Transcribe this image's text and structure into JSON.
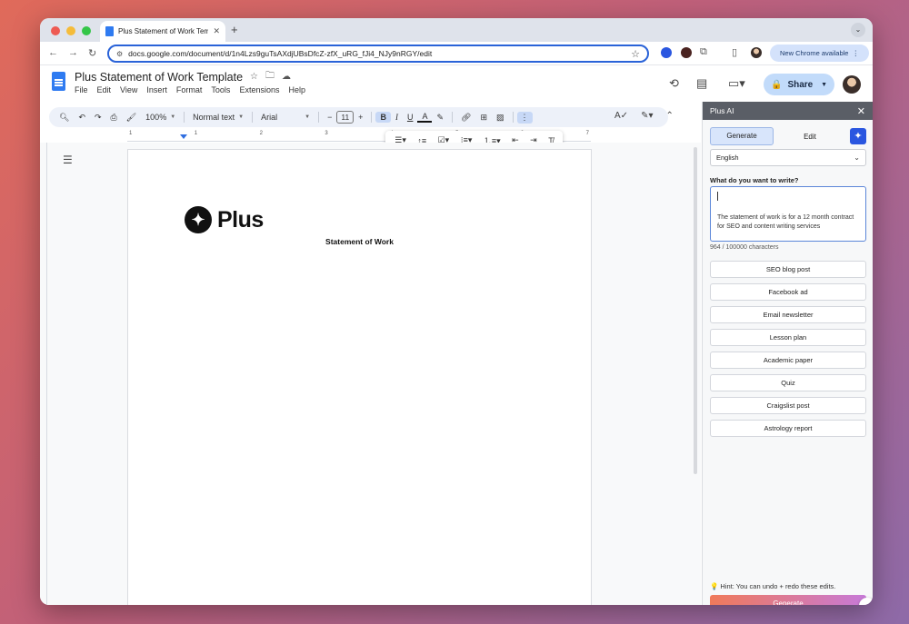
{
  "browser": {
    "tab_title": "Plus Statement of Work Temp",
    "tab_close": "✕",
    "new_tab": "+",
    "url": "docs.google.com/document/d/1n4Lzs9guTsAXdjUBsDfcZ-zfX_uRG_fJi4_NJy9nRGY/edit",
    "chrome_update_label": "New Chrome available",
    "traffic_colors": [
      "#ee5b53",
      "#f5bc3a",
      "#34c648"
    ]
  },
  "docs": {
    "title": "Plus Statement of Work Template",
    "menus": [
      "File",
      "Edit",
      "View",
      "Insert",
      "Format",
      "Tools",
      "Extensions",
      "Help"
    ],
    "share_label": "Share",
    "toolbar": {
      "zoom": "100%",
      "style": "Normal text",
      "font": "Arial",
      "font_size": "11"
    },
    "ruler_numbers": [
      "1",
      "1",
      "2",
      "3",
      "4",
      "5",
      "6",
      "7"
    ]
  },
  "document": {
    "logo_word": "Plus",
    "heading": "Statement of Work"
  },
  "panel": {
    "title": "Plus AI",
    "tab_generate": "Generate",
    "tab_edit": "Edit",
    "language": "English",
    "question": "What do you want to write?",
    "prompt_text": "The statement of work is for a 12 month contract for SEO and content writing services",
    "char_count": "964 / 100000 characters",
    "templates": [
      "SEO blog post",
      "Facebook ad",
      "Email newsletter",
      "Lesson plan",
      "Academic paper",
      "Quiz",
      "Craigslist post",
      "Astrology report"
    ],
    "hint": "💡 Hint: You can undo + redo these edits.",
    "generate_button": "Generate"
  }
}
